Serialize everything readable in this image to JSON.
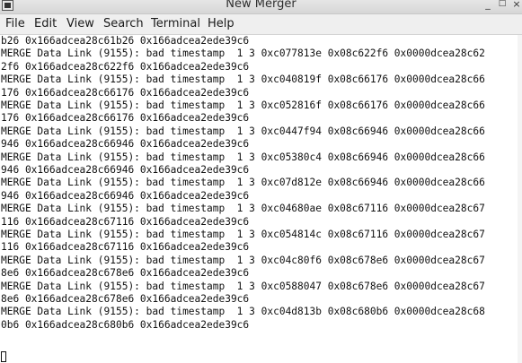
{
  "window": {
    "title": "New Merger",
    "minimize_glyph": "_",
    "maximize_glyph": "□",
    "close_glyph": "×"
  },
  "menubar": {
    "items": [
      "File",
      "Edit",
      "View",
      "Search",
      "Terminal",
      "Help"
    ]
  },
  "terminal": {
    "lines": [
      "b26 0x166adcea28c61b26 0x166adcea2ede39c6",
      "MERGE Data Link (9155): bad timestamp  1 3 0xc077813e 0x08c622f6 0x0000dcea28c62",
      "2f6 0x166adcea28c622f6 0x166adcea2ede39c6",
      "MERGE Data Link (9155): bad timestamp  1 3 0xc040819f 0x08c66176 0x0000dcea28c66",
      "176 0x166adcea28c66176 0x166adcea2ede39c6",
      "MERGE Data Link (9155): bad timestamp  1 3 0xc052816f 0x08c66176 0x0000dcea28c66",
      "176 0x166adcea28c66176 0x166adcea2ede39c6",
      "MERGE Data Link (9155): bad timestamp  1 3 0xc0447f94 0x08c66946 0x0000dcea28c66",
      "946 0x166adcea28c66946 0x166adcea2ede39c6",
      "MERGE Data Link (9155): bad timestamp  1 3 0xc05380c4 0x08c66946 0x0000dcea28c66",
      "946 0x166adcea28c66946 0x166adcea2ede39c6",
      "MERGE Data Link (9155): bad timestamp  1 3 0xc07d812e 0x08c66946 0x0000dcea28c66",
      "946 0x166adcea28c66946 0x166adcea2ede39c6",
      "MERGE Data Link (9155): bad timestamp  1 3 0xc04680ae 0x08c67116 0x0000dcea28c67",
      "116 0x166adcea28c67116 0x166adcea2ede39c6",
      "MERGE Data Link (9155): bad timestamp  1 3 0xc054814c 0x08c67116 0x0000dcea28c67",
      "116 0x166adcea28c67116 0x166adcea2ede39c6",
      "MERGE Data Link (9155): bad timestamp  1 3 0xc04c80f6 0x08c678e6 0x0000dcea28c67",
      "8e6 0x166adcea28c678e6 0x166adcea2ede39c6",
      "MERGE Data Link (9155): bad timestamp  1 3 0xc0588047 0x08c678e6 0x0000dcea28c67",
      "8e6 0x166adcea28c678e6 0x166adcea2ede39c6",
      "MERGE Data Link (9155): bad timestamp  1 3 0xc04d813b 0x08c680b6 0x0000dcea28c68",
      "0b6 0x166adcea28c680b6 0x166adcea2ede39c6"
    ]
  }
}
